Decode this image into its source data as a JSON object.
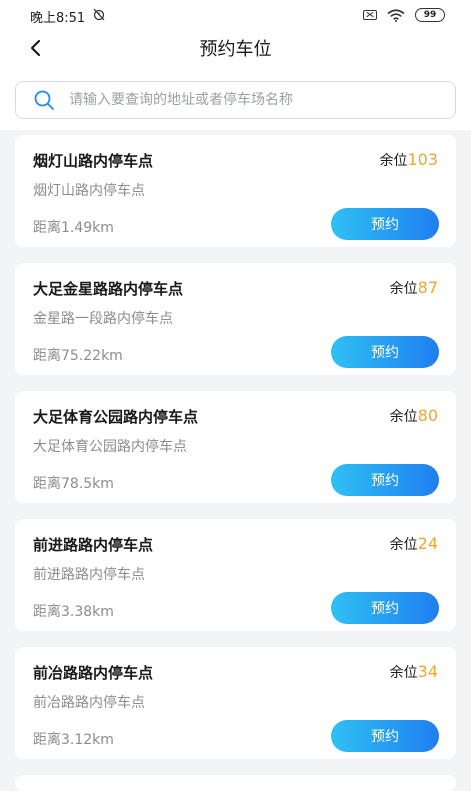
{
  "status_bar": {
    "time": "晚上8:51",
    "battery": "99"
  },
  "header": {
    "title": "预约车位"
  },
  "search": {
    "placeholder": "请输入要查询的地址或者停车场名称"
  },
  "remain_label": "余位",
  "reserve_label": "预约",
  "lots": [
    {
      "name": "烟灯山路内停车点",
      "address": "烟灯山路内停车点",
      "remaining": "103",
      "distance": "距离1.49km"
    },
    {
      "name": "大足金星路路内停车点",
      "address": "金星路一段路内停车点",
      "remaining": "87",
      "distance": "距离75.22km"
    },
    {
      "name": "大足体育公园路内停车点",
      "address": "大足体育公园路内停车点",
      "remaining": "80",
      "distance": "距离78.5km"
    },
    {
      "name": "前进路路内停车点",
      "address": "前进路路内停车点",
      "remaining": "24",
      "distance": "距离3.38km"
    },
    {
      "name": "前冶路路内停车点",
      "address": "前冶路路内停车点",
      "remaining": "34",
      "distance": "距离3.12km"
    }
  ],
  "colors": {
    "accent_orange": "#f2a530",
    "button_start": "#2fc0f4",
    "button_end": "#1f7fef"
  }
}
